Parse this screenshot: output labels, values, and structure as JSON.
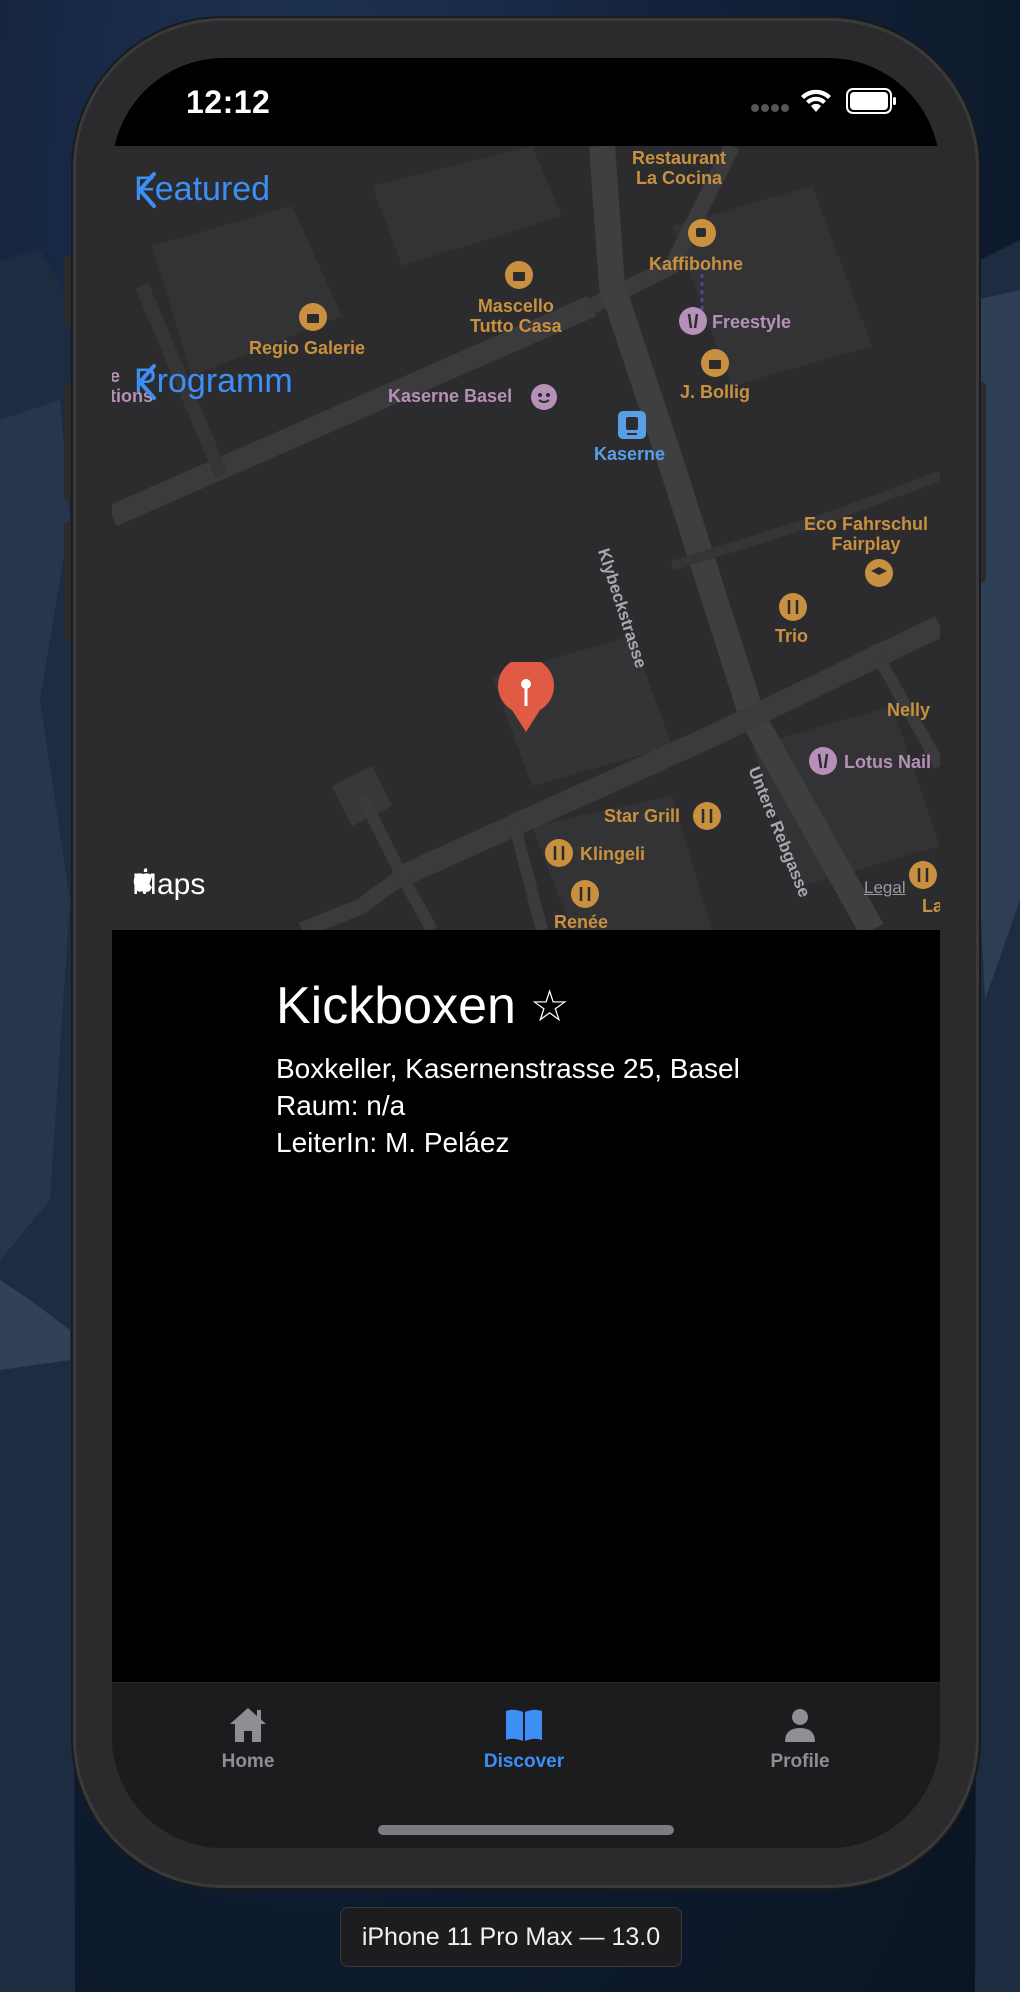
{
  "status_bar": {
    "time": "12:12"
  },
  "navigation": {
    "back_featured": "Featured",
    "back_programm": "Programm"
  },
  "map": {
    "attribution": "Maps",
    "legal": "Legal",
    "pin_color": "#e05a44",
    "pois": {
      "restaurant_la_cocina": "Restaurant\nLa Cocina",
      "kaffibohne": "Kaffibohne",
      "mascello": "Mascello\nTutto Casa",
      "freestyle": "Freestyle",
      "regio_galerie": "Regio Galerie",
      "j_bollig": "J. Bollig",
      "kaserne_basel": "Kaserne Basel",
      "kaserne": "Kaserne",
      "eco_fahrschule": "Eco Fahrschul\nFairplay",
      "trio": "Trio",
      "nelly": "Nelly",
      "lotus_nail": "Lotus Nail",
      "star_grill": "Star Grill",
      "klingeli": "Klingeli",
      "renee": "Renée",
      "lalibe": "Lalibe",
      "partial_left": "e\ntions"
    },
    "streets": {
      "klybeckstrasse": "Klybeckstrasse",
      "untere_rebgasse": "Untere Rebgasse"
    }
  },
  "detail": {
    "title": "Kickboxen",
    "favorite_icon": "☆",
    "address": "Boxkeller, Kasernenstrasse 25, Basel",
    "room": "Raum: n/a",
    "leader": "LeiterIn: M. Peláez"
  },
  "tab_bar": {
    "tabs": [
      {
        "label": "Home",
        "icon": "house-icon",
        "active": false
      },
      {
        "label": "Discover",
        "icon": "book-icon",
        "active": true
      },
      {
        "label": "Profile",
        "icon": "person-icon",
        "active": false
      }
    ]
  },
  "device_label": "iPhone 11 Pro Max — 13.0",
  "colors": {
    "accent": "#3d8ef5",
    "tab_inactive": "#8e8e93",
    "poi_orange": "#c9913f",
    "poi_purple": "#b690b8"
  }
}
